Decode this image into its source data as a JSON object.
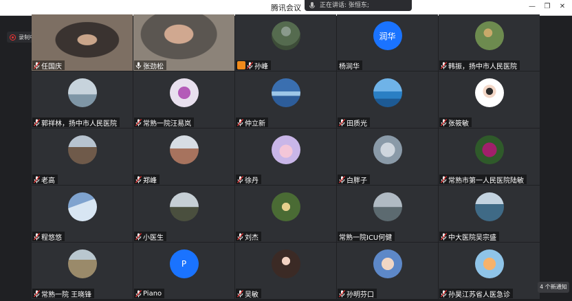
{
  "window": {
    "title": "腾讯会议",
    "controls": [
      "—",
      "❐",
      "✕"
    ]
  },
  "speaking": {
    "label": "正在讲话: 张恒东;"
  },
  "recording": {
    "label": "录制中"
  },
  "notice": {
    "label": "4 个新通知"
  },
  "participants": [
    {
      "name": "任国庆",
      "mic": "muted"
    },
    {
      "name": "张劲松",
      "mic": "on"
    },
    {
      "name": "孙峰",
      "mic": "muted",
      "share": true
    },
    {
      "name": "杨润华",
      "mic": "none",
      "avatar_letter": "润华"
    },
    {
      "name": "韩振，扬中市人民医院",
      "mic": "muted"
    },
    {
      "name": "郭祥林，扬中市人民医院",
      "mic": "muted"
    },
    {
      "name": "常熟一院汪易岚",
      "mic": "muted"
    },
    {
      "name": "仲立新",
      "mic": "muted"
    },
    {
      "name": "田质光",
      "mic": "muted"
    },
    {
      "name": "张筱敏",
      "mic": "muted"
    },
    {
      "name": "老高",
      "mic": "muted"
    },
    {
      "name": "郑峰",
      "mic": "muted"
    },
    {
      "name": "徐丹",
      "mic": "muted"
    },
    {
      "name": "白胖子",
      "mic": "muted"
    },
    {
      "name": "常熟市第一人民医院陆敏",
      "mic": "muted"
    },
    {
      "name": "程悠悠",
      "mic": "muted"
    },
    {
      "name": "小医生",
      "mic": "muted"
    },
    {
      "name": "刘杰",
      "mic": "muted"
    },
    {
      "name": "常熟一院ICU何健",
      "mic": "none"
    },
    {
      "name": "中大医院吴宗盛",
      "mic": "muted"
    },
    {
      "name": "常熟一院 王晓锋",
      "mic": "muted"
    },
    {
      "name": "Piano",
      "mic": "muted",
      "avatar_letter": "P"
    },
    {
      "name": "吴敏",
      "mic": "muted"
    },
    {
      "name": "孙明芬口",
      "mic": "muted"
    },
    {
      "name": "孙昊江苏省人医急诊",
      "mic": "muted"
    }
  ]
}
